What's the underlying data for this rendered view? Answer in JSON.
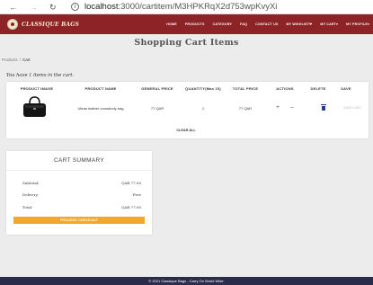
{
  "browser": {
    "url_host": "localhost",
    "url_rest": ":3000/cartitem/M3HPKRqX2d753wpKvyXi"
  },
  "header": {
    "logo_text": "CLASSIQUE BAGS",
    "nav": [
      "HOME",
      "PRODUCTS",
      "CATEGORY",
      "FAQ",
      "CONTACT US",
      "MY WISHLIST❤",
      "MY CART▾",
      "MY PROFILE▾"
    ]
  },
  "page": {
    "title": "Shopping Cart Items",
    "breadcrumb": [
      "Products",
      "Cart"
    ],
    "items_count_text": "You have 1 items in the cart."
  },
  "cart": {
    "columns": [
      "PRODUCT IMAGE",
      "PRODUCT NAME",
      "GENERAL PRICE",
      "QUANTITY(Max 10)",
      "TOTAL PRICE",
      "ACTIONS",
      "DELETE",
      "SAVE"
    ],
    "rows": [
      {
        "name": "Ultras leather crossbody bag",
        "price": "77 QAR",
        "quantity": "1",
        "total": "77 QAR",
        "save_label": "SAVE CART"
      }
    ],
    "clear_all": "CLEAR ALL"
  },
  "summary": {
    "title": "CART SUMMARY",
    "subtotal_label": "Subtotal:",
    "subtotal_value": "QAR 77.00",
    "delivery_label": "Delivery:",
    "delivery_value": "Free",
    "total_label": "Total:",
    "total_value": "QAR 77.00",
    "checkout_label": "PROCEED CHECKOUT"
  },
  "footer": {
    "text": "© 2021 Classique Bags - Carry On World Wide."
  },
  "colors": {
    "header": "#8b2327",
    "checkout": "#f3a72b",
    "footer": "#2b2b4a",
    "action_icon": "#1f3e8c"
  }
}
